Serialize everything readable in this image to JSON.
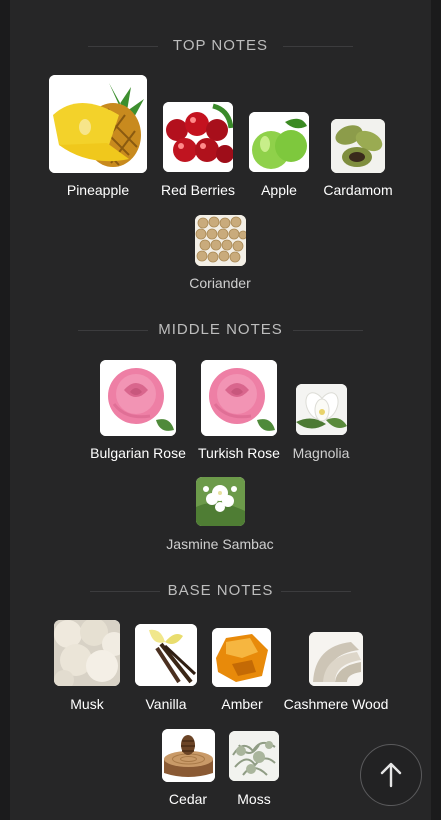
{
  "sections": {
    "top": {
      "title": "TOP NOTES",
      "notes": [
        {
          "label": "Pineapple",
          "icon": "pineapple-image"
        },
        {
          "label": "Red Berries",
          "icon": "red-berries-image"
        },
        {
          "label": "Apple",
          "icon": "apple-image"
        },
        {
          "label": "Cardamom",
          "icon": "cardamom-image"
        },
        {
          "label": "Coriander",
          "icon": "coriander-image"
        }
      ]
    },
    "middle": {
      "title": "MIDDLE NOTES",
      "notes": [
        {
          "label": "Bulgarian Rose",
          "icon": "rose-image"
        },
        {
          "label": "Turkish Rose",
          "icon": "rose-image"
        },
        {
          "label": "Magnolia",
          "icon": "magnolia-image"
        },
        {
          "label": "Jasmine Sambac",
          "icon": "jasmine-image"
        }
      ]
    },
    "base": {
      "title": "BASE NOTES",
      "notes": [
        {
          "label": "Musk",
          "icon": "musk-image"
        },
        {
          "label": "Vanilla",
          "icon": "vanilla-image"
        },
        {
          "label": "Amber",
          "icon": "amber-image"
        },
        {
          "label": "Cashmere Wood",
          "icon": "cashmere-wood-image"
        },
        {
          "label": "Cedar",
          "icon": "cedar-image"
        },
        {
          "label": "Moss",
          "icon": "moss-image"
        }
      ]
    }
  },
  "scroll_top_icon": "arrow-up-icon",
  "colors": {
    "background": "#1b1b1c",
    "panel": "#262627",
    "text": "#e8e8e8"
  }
}
